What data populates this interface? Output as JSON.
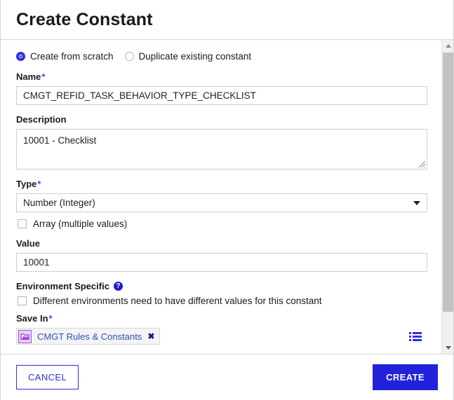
{
  "header": {
    "title": "Create Constant"
  },
  "mode": {
    "options": [
      {
        "label": "Create from scratch",
        "selected": true
      },
      {
        "label": "Duplicate existing constant",
        "selected": false
      }
    ]
  },
  "fields": {
    "name": {
      "label": "Name",
      "required_marker": "*",
      "value": "CMGT_REFID_TASK_BEHAVIOR_TYPE_CHECKLIST",
      "placeholder": ""
    },
    "description": {
      "label": "Description",
      "value": "10001 - Checklist",
      "placeholder": ""
    },
    "type": {
      "label": "Type",
      "required_marker": "*",
      "value": "Number (Integer)",
      "options": [
        "Number (Integer)"
      ]
    },
    "array": {
      "label": "Array (multiple values)",
      "checked": false
    },
    "value": {
      "label": "Value",
      "value": "10001",
      "placeholder": ""
    },
    "environment_specific": {
      "label": "Environment Specific",
      "help_icon": "help-circle-icon",
      "checkbox_label": "Different environments need to have different values for this constant",
      "checked": false
    },
    "save_in": {
      "label": "Save In",
      "required_marker": "*",
      "chip_label": "CMGT Rules & Constants",
      "chip_icon": "folder-icon",
      "chip_close_icon": "close-icon",
      "picker_icon": "list-picker-icon"
    }
  },
  "scrollbar": {
    "up_icon": "scroll-up-arrow-icon",
    "down_icon": "scroll-down-arrow-icon"
  },
  "footer": {
    "cancel_label": "CANCEL",
    "create_label": "CREATE"
  },
  "colors": {
    "accent_blue": "#2222dd",
    "link_blue": "#2f4fc0",
    "folder_purple": "#a24fd6",
    "required_star": "#4a4ae8"
  }
}
